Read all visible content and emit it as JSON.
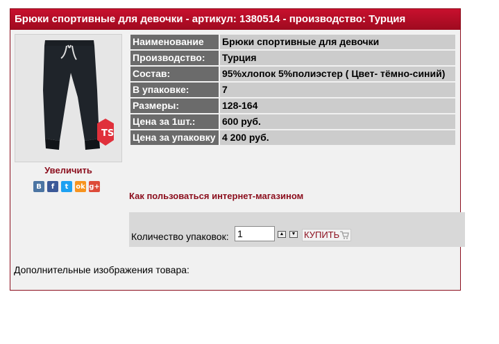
{
  "product": {
    "header": "Брюки спортивные для девочки - артикул: 1380514 - производство: Турция",
    "zoom_label": "Увеличить",
    "howto_link": "Как пользоваться интернет-магазином",
    "quantity_label": "Количество упаковок:",
    "quantity_value": "1",
    "buy_label": "КУПИТЬ",
    "extra_images_label": "Дополнительные изображения товара:",
    "brand_logo_text": "TS",
    "properties": [
      {
        "key": "Наименование",
        "value": "Брюки спортивные для девочки"
      },
      {
        "key": "Производство:",
        "value": "Турция"
      },
      {
        "key": "Состав:",
        "value": "95%хлопок 5%полиэстер ( Цвет- тёмно-синий)"
      },
      {
        "key": "В упаковке:",
        "value": "7"
      },
      {
        "key": "Размеры:",
        "value": "128-164"
      },
      {
        "key": "Цена за 1шт.:",
        "value": "600 руб."
      },
      {
        "key": "Цена за упаковку",
        "value": "4 200 руб."
      }
    ]
  },
  "social": [
    {
      "icon": "vk-icon",
      "glyph": "B",
      "color": "#4c75a3"
    },
    {
      "icon": "facebook-icon",
      "glyph": "f",
      "color": "#3b5998"
    },
    {
      "icon": "twitter-icon",
      "glyph": "t",
      "color": "#1da1f2"
    },
    {
      "icon": "odnoklassniki-icon",
      "glyph": "ok",
      "color": "#f7931e"
    },
    {
      "icon": "google-plus-icon",
      "glyph": "g+",
      "color": "#dd4b39"
    }
  ],
  "colors": {
    "header_bg": "#b00d24",
    "link": "#8b0d1c",
    "label_cell": "#6b6b6b",
    "value_cell": "#cccccc"
  }
}
